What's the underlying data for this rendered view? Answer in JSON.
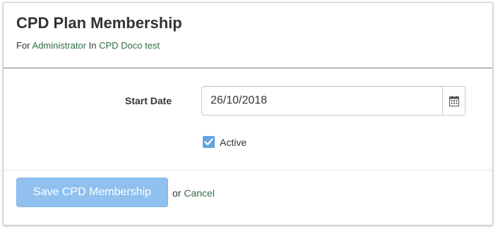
{
  "header": {
    "title": "CPD Plan Membership",
    "subtitle_for": "For",
    "user_link": "Administrator",
    "subtitle_in": "In",
    "plan_link": "CPD Doco test"
  },
  "form": {
    "start_date_label": "Start Date",
    "start_date_value": "26/10/2018",
    "calendar_icon": "calendar-icon",
    "active_label": "Active",
    "active_checked": true
  },
  "footer": {
    "save_label": "Save CPD Membership",
    "or_text": "or",
    "cancel_label": "Cancel"
  },
  "colors": {
    "link": "#2e6e45",
    "save_button": "#8fc0ee",
    "checkbox": "#66a3e0"
  }
}
